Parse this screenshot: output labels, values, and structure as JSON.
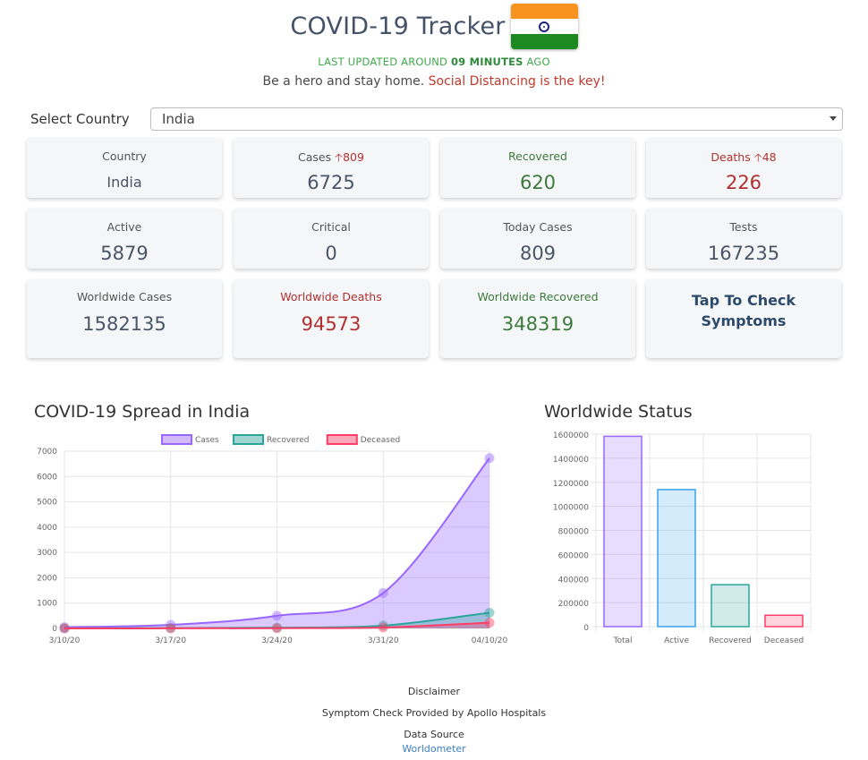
{
  "header": {
    "title": "COVID-19 Tracker",
    "updated_prefix": "LAST UPDATED AROUND",
    "updated_value": "09 MINUTES",
    "updated_suffix": "AGO",
    "tagline_main": "Be a hero and stay home.",
    "tagline_emphasis": "Social Distancing is the key!",
    "flag_icon": "india-flag-icon"
  },
  "country_select": {
    "label": "Select Country",
    "selected": "India"
  },
  "cards": {
    "country": {
      "label": "Country",
      "value": "India"
    },
    "cases": {
      "label": "Cases",
      "increase": "809",
      "value": "6725"
    },
    "recovered": {
      "label": "Recovered",
      "value": "620"
    },
    "deaths": {
      "label": "Deaths",
      "increase": "48",
      "value": "226"
    },
    "active": {
      "label": "Active",
      "value": "5879"
    },
    "critical": {
      "label": "Critical",
      "value": "0"
    },
    "today_cases": {
      "label": "Today Cases",
      "value": "809"
    },
    "tests": {
      "label": "Tests",
      "value": "167235"
    },
    "worldwide_cases": {
      "label": "Worldwide Cases",
      "value": "1582135"
    },
    "worldwide_deaths": {
      "label": "Worldwide Deaths",
      "value": "94573"
    },
    "worldwide_recovered": {
      "label": "Worldwide Recovered",
      "value": "348319"
    },
    "symptoms": {
      "label": "Tap To Check Symptoms"
    }
  },
  "colors": {
    "cases": "#9966ff",
    "recovered": "#2aa59a",
    "deceased": "#ff3d67",
    "active": "#36a2eb",
    "green_text": "#3c7a3c",
    "red_text": "#b03030"
  },
  "sections": {
    "spread_title": "COVID-19 Spread in India",
    "worldwide_title": "Worldwide Status"
  },
  "chart_data": [
    {
      "type": "area",
      "title": "COVID-19 Spread in India",
      "x": [
        "3/10/20",
        "3/17/20",
        "3/24/20",
        "3/31/20",
        "04/10/20"
      ],
      "ylim": [
        0,
        7000
      ],
      "yticks": [
        0,
        1000,
        2000,
        3000,
        4000,
        5000,
        6000,
        7000
      ],
      "legend_position": "top",
      "grid": true,
      "series": [
        {
          "name": "Cases",
          "values": [
            50,
            140,
            500,
            1400,
            6725
          ]
        },
        {
          "name": "Recovered",
          "values": [
            4,
            14,
            30,
            110,
            620
          ]
        },
        {
          "name": "Deceased",
          "values": [
            2,
            3,
            10,
            35,
            226
          ]
        }
      ]
    },
    {
      "type": "bar",
      "title": "Worldwide Status",
      "categories": [
        "Total",
        "Active",
        "Recovered",
        "Deceased"
      ],
      "values": [
        1582135,
        1139243,
        348319,
        94573
      ],
      "ylim": [
        0,
        1600000
      ],
      "yticks": [
        0,
        200000,
        400000,
        600000,
        800000,
        1000000,
        1200000,
        1400000,
        1600000
      ],
      "grid": true
    }
  ],
  "footer": {
    "disclaimer": "Disclaimer",
    "symptom_credit": "Symptom Check Provided by Apollo Hospitals",
    "data_source_label": "Data Source",
    "data_source_link": "Worldometer"
  }
}
